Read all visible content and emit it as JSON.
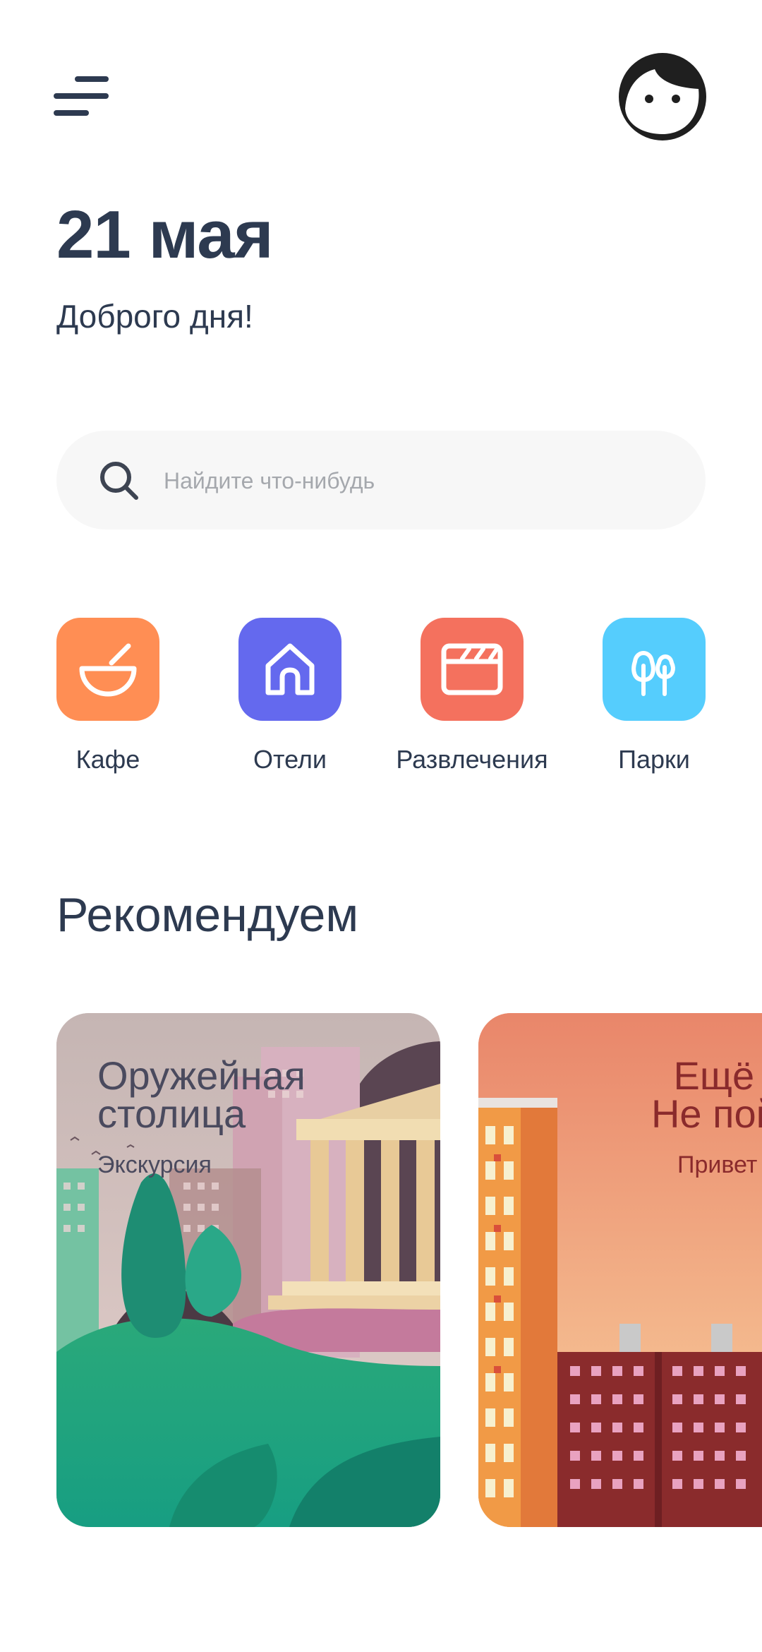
{
  "header": {
    "menu_icon": "menu-icon",
    "avatar_icon": "face-avatar-icon",
    "date": "21 мая",
    "greeting": "Доброго дня!"
  },
  "search": {
    "placeholder": "Найдите что-нибудь",
    "icon": "search-icon"
  },
  "categories": [
    {
      "label": "Кафе",
      "icon": "bowl-icon",
      "color": "#ff8e54"
    },
    {
      "label": "Отели",
      "icon": "house-icon",
      "color": "#6469ee"
    },
    {
      "label": "Развлечения",
      "icon": "clapperboard-icon",
      "color": "#f4715e"
    },
    {
      "label": "Парки",
      "icon": "trees-icon",
      "color": "#55cdfd"
    }
  ],
  "recommended": {
    "title": "Рекомендуем",
    "cards": [
      {
        "title": "Оружейная\nстолица",
        "subtitle": "Экскурсия"
      },
      {
        "title": "Ещё что\nНе пойму",
        "subtitle": "Привет"
      }
    ]
  }
}
